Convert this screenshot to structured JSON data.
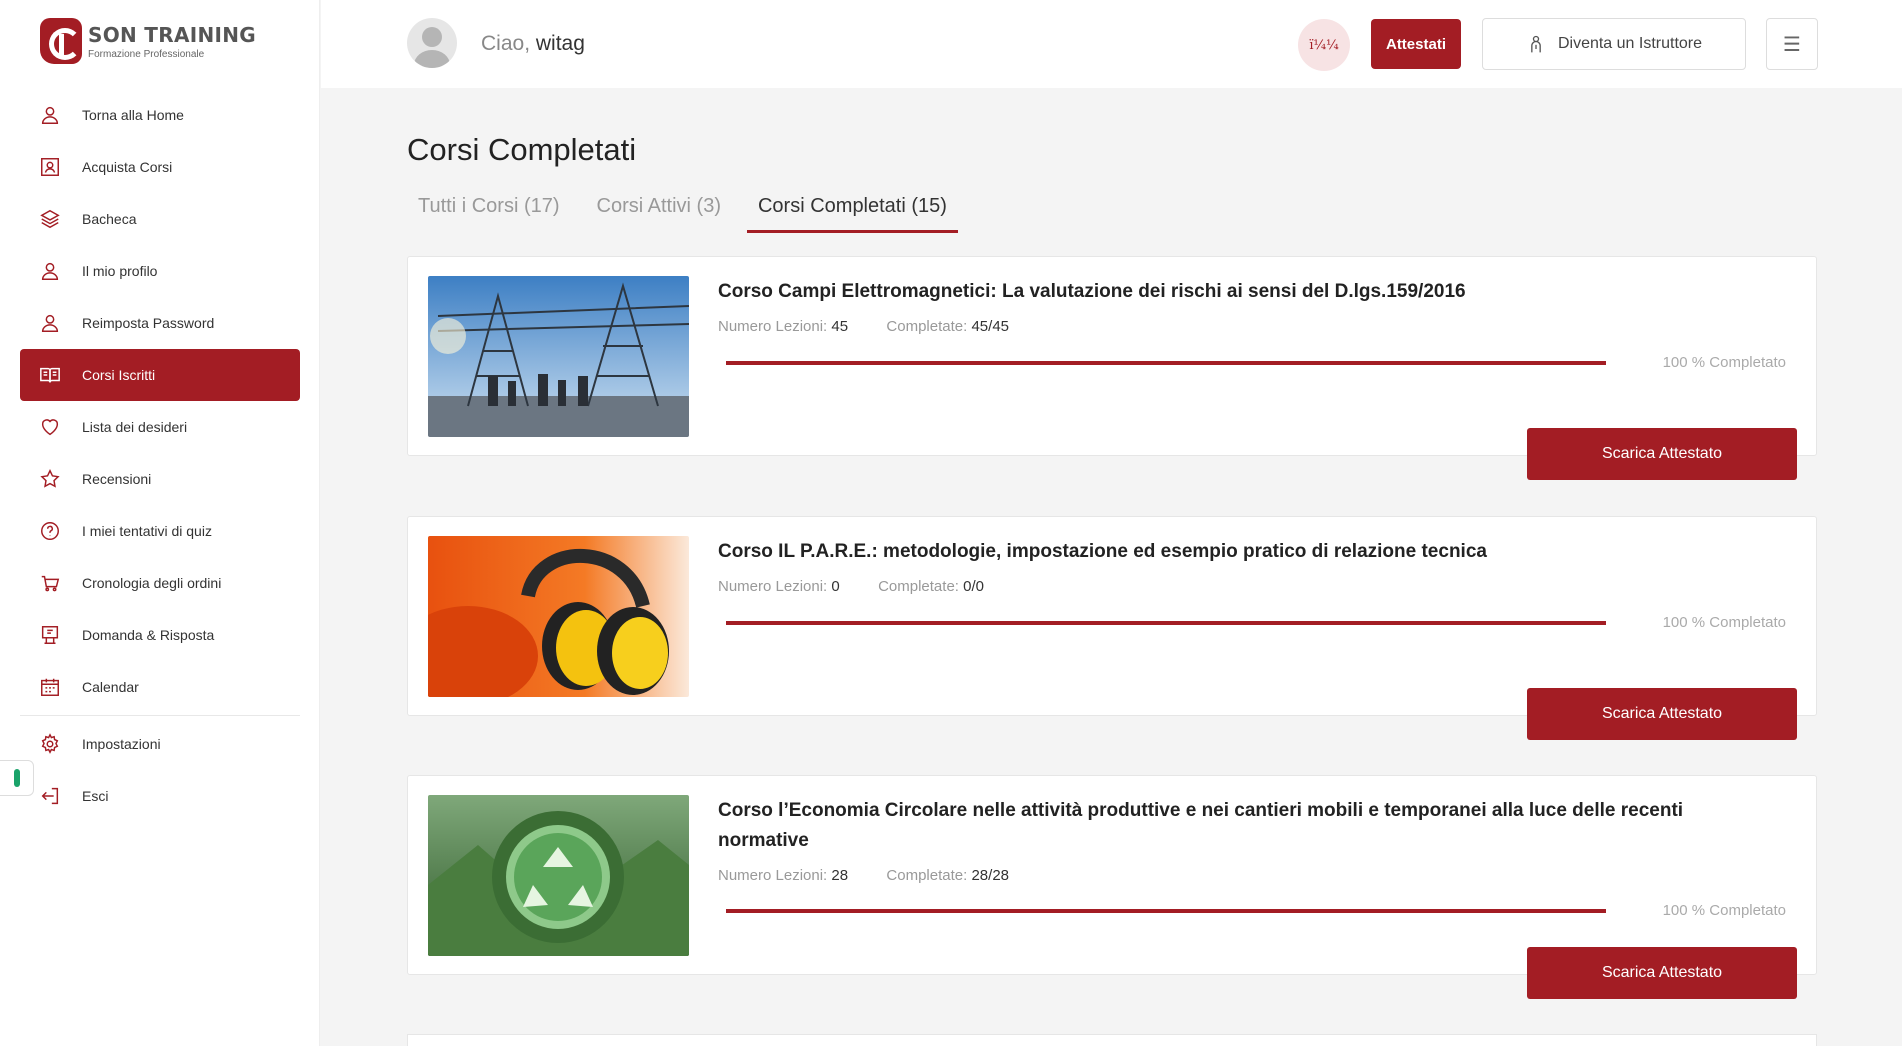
{
  "brand": {
    "title": "SON TRAINING",
    "subtitle": "Formazione Professionale"
  },
  "sidebar": {
    "items": [
      {
        "label": "Torna alla Home",
        "icon": "user-icon"
      },
      {
        "label": "Acquista Corsi",
        "icon": "id-card-icon"
      },
      {
        "label": "Bacheca",
        "icon": "layers-icon"
      },
      {
        "label": "Il mio profilo",
        "icon": "user-icon"
      },
      {
        "label": "Reimposta Password",
        "icon": "user-icon"
      },
      {
        "label": "Corsi Iscritti",
        "icon": "open-book-icon",
        "active": true
      },
      {
        "label": "Lista dei desideri",
        "icon": "heart-icon"
      },
      {
        "label": "Recensioni",
        "icon": "star-icon"
      },
      {
        "label": "I miei tentativi di quiz",
        "icon": "question-icon"
      },
      {
        "label": "Cronologia degli ordini",
        "icon": "cart-icon"
      },
      {
        "label": "Domanda & Risposta",
        "icon": "qa-icon"
      },
      {
        "label": "Calendar",
        "icon": "calendar-icon"
      },
      {
        "label": "Impostazioni",
        "icon": "gear-icon"
      },
      {
        "label": "Esci",
        "icon": "logout-icon"
      }
    ]
  },
  "header": {
    "greeting": "Ciao,",
    "username": "witag",
    "notification_text": "ï¼¼",
    "attestati_label": "Attestati",
    "istruttore_label": "Diventa un Istruttore",
    "menu_icon": "hamburger-icon"
  },
  "main": {
    "title": "Corsi Completati",
    "tabs": [
      {
        "label": "Tutti i Corsi (17)"
      },
      {
        "label": "Corsi Attivi (3)"
      },
      {
        "label": "Corsi Completati (15)",
        "active": true
      }
    ],
    "labels": {
      "lessons": "Numero Lezioni:",
      "completed": "Completate:",
      "percent_suffix": "100 % Completato",
      "download": "Scarica Attestato"
    },
    "courses": [
      {
        "title": "Corso Campi Elettromagnetici: La valutazione dei rischi ai sensi del D.lgs.159/2016",
        "lessons": "45",
        "completed": "45/45",
        "progress": 1.0,
        "image": "electrical-substation"
      },
      {
        "title": "Corso IL P.A.R.E.: metodologie, impostazione ed esempio pratico di relazione tecnica",
        "lessons": "0",
        "completed": "0/0",
        "progress": 1.0,
        "image": "ear-protection-headphones"
      },
      {
        "title": "Corso l’Economia Circolare nelle attività produttive e nei cantieri mobili e temporanei alla luce delle recenti normative",
        "lessons": "28",
        "completed": "28/28",
        "progress": 1.0,
        "image": "recycling-symbol"
      }
    ]
  },
  "colors": {
    "accent": "#a31d24",
    "background": "#f4f4f4"
  }
}
